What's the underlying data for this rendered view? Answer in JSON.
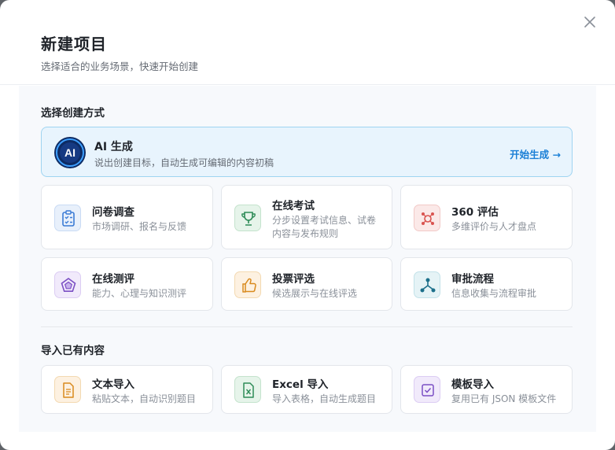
{
  "dialog": {
    "title": "新建项目",
    "subtitle": "选择适合的业务场景，快速开始创建"
  },
  "sections": {
    "create": "选择创建方式",
    "import": "导入已有内容"
  },
  "ai_card": {
    "logo_text": "AI",
    "title": "AI 生成",
    "desc": "说出创建目标，自动生成可编辑的内容初稿",
    "action": "开始生成 →"
  },
  "create_cards": [
    {
      "title": "问卷调查",
      "desc": "市场调研、报名与反馈",
      "icon": "clipboard-checklist-icon",
      "color": "#3a7bd5"
    },
    {
      "title": "在线考试",
      "desc": "分步设置考试信息、试卷内容与发布规则",
      "icon": "trophy-icon",
      "color": "#2e8b57"
    },
    {
      "title": "360 评估",
      "desc": "多维评价与人才盘点",
      "icon": "network-target-icon",
      "color": "#d9534f"
    },
    {
      "title": "在线测评",
      "desc": "能力、心理与知识测评",
      "icon": "radar-pentagon-icon",
      "color": "#7b4fc4"
    },
    {
      "title": "投票评选",
      "desc": "候选展示与在线评选",
      "icon": "thumbs-up-icon",
      "color": "#d98a1e"
    },
    {
      "title": "审批流程",
      "desc": "信息收集与流程审批",
      "icon": "workflow-icon",
      "color": "#1b6f8a"
    }
  ],
  "import_cards": [
    {
      "title": "文本导入",
      "desc": "粘贴文本，自动识别题目",
      "icon": "text-document-icon",
      "color": "#d98a1e"
    },
    {
      "title": "Excel 导入",
      "desc": "导入表格，自动生成题目",
      "icon": "excel-file-icon",
      "color": "#2e8b57"
    },
    {
      "title": "模板导入",
      "desc": "复用已有 JSON 模板文件",
      "icon": "template-check-icon",
      "color": "#7b4fc4"
    }
  ]
}
